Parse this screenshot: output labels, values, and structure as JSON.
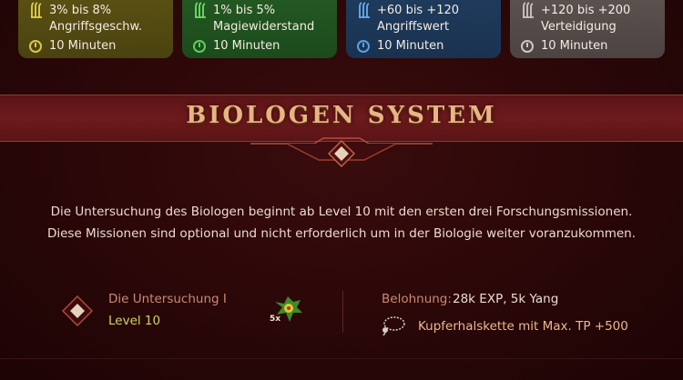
{
  "buff_cards": [
    {
      "line1": "3% bis 8%",
      "line2": "Angriffsgeschw.",
      "duration": "10 Minuten",
      "icon": "claw-icon",
      "icon_color": "#e6d24a",
      "clock_color": "#d8c84a"
    },
    {
      "line1": "1% bis 5%",
      "line2": "Magiewiderstand",
      "duration": "10 Minuten",
      "icon": "claw-icon",
      "icon_color": "#6fe06a",
      "clock_color": "#5ed05a"
    },
    {
      "line1": "+60 bis +120",
      "line2": "Angriffswert",
      "duration": "10 Minuten",
      "icon": "claw-icon",
      "icon_color": "#6aaef0",
      "clock_color": "#5aa0e8"
    },
    {
      "line1": "+120 bis +200",
      "line2": "Verteidigung",
      "duration": "10 Minuten",
      "icon": "claw-icon",
      "icon_color": "#d0c8c4",
      "clock_color": "#cfc6c2"
    }
  ],
  "banner": {
    "title": "BIOLOGEN SYSTEM"
  },
  "description": {
    "line1": "Die Untersuchung des Biologen beginnt ab Level 10 mit den ersten drei Forschungsmissionen.",
    "line2": "Diese Missionen sind optional und nicht erforderlich um in der Biologie weiter voranzukommen."
  },
  "mission": {
    "title": "Die Untersuchung I",
    "level": "Level 10",
    "item_count": "5x",
    "reward_label": "Belohnung:",
    "reward_value": "28k EXP, 5k Yang",
    "bonus_item": "Kupferhalskette mit Max. TP +500"
  },
  "colors": {
    "accent_gold": "#e7b583",
    "banner_red": "#6e1a1c",
    "level_green": "#c7d860"
  }
}
